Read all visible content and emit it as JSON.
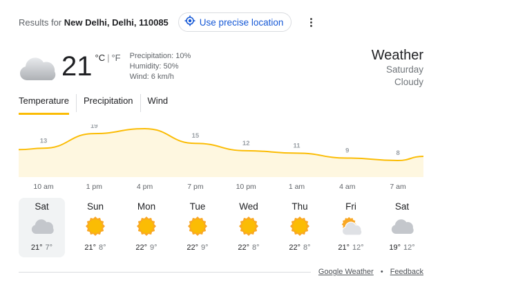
{
  "location": {
    "prefix": "Results for",
    "place": "New Delhi, Delhi, 110085",
    "precise_button": "Use precise location"
  },
  "current": {
    "temp": "21",
    "unit_c": "°C",
    "unit_f": "°F",
    "precipitation": "Precipitation: 10%",
    "humidity": "Humidity: 50%",
    "wind": "Wind: 6 km/h",
    "icon": "cloudy-icon"
  },
  "title": {
    "heading": "Weather",
    "day": "Saturday",
    "condition": "Cloudy"
  },
  "tabs": [
    "Temperature",
    "Precipitation",
    "Wind"
  ],
  "chart_data": {
    "type": "area",
    "x": [
      "10 am",
      "1 pm",
      "4 pm",
      "7 pm",
      "10 pm",
      "1 am",
      "4 am",
      "7 am"
    ],
    "y": [
      13,
      19,
      21,
      15,
      12,
      11,
      9,
      8
    ],
    "color": "#fbbc04",
    "fill": "#fef7e0"
  },
  "days": [
    {
      "name": "Sat",
      "icon": "cloudy-icon",
      "high": "21°",
      "low": "7°"
    },
    {
      "name": "Sun",
      "icon": "sunny-icon",
      "high": "21°",
      "low": "8°"
    },
    {
      "name": "Mon",
      "icon": "sunny-icon",
      "high": "22°",
      "low": "9°"
    },
    {
      "name": "Tue",
      "icon": "sunny-icon",
      "high": "22°",
      "low": "9°"
    },
    {
      "name": "Wed",
      "icon": "sunny-icon",
      "high": "22°",
      "low": "8°"
    },
    {
      "name": "Thu",
      "icon": "sunny-icon",
      "high": "22°",
      "low": "8°"
    },
    {
      "name": "Fri",
      "icon": "partly-cloudy-icon",
      "high": "21°",
      "low": "12°"
    },
    {
      "name": "Sat",
      "icon": "cloudy-icon",
      "high": "19°",
      "low": "12°"
    }
  ],
  "footer": {
    "source": "Google Weather",
    "feedback": "Feedback"
  }
}
